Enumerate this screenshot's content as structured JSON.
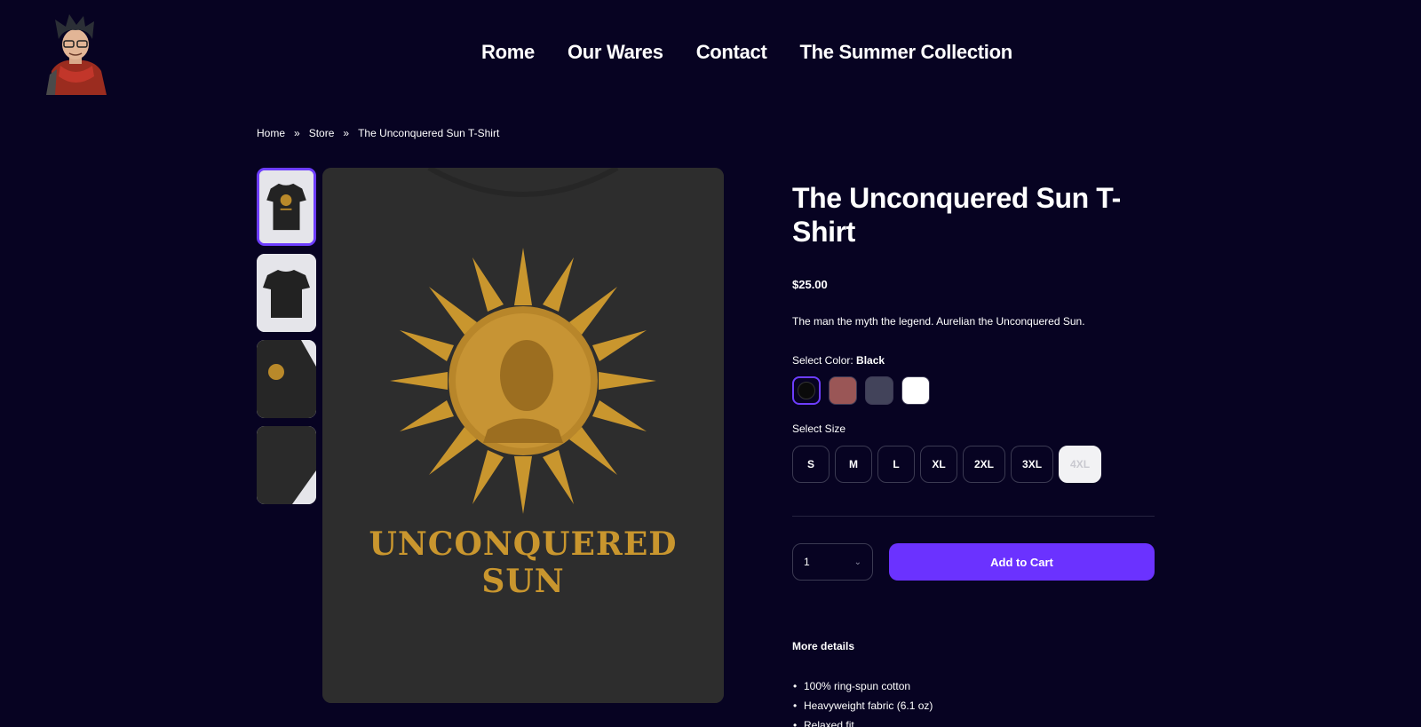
{
  "nav": {
    "items": [
      "Rome",
      "Our Wares",
      "Contact",
      "The Summer Collection"
    ]
  },
  "breadcrumb": {
    "home": "Home",
    "sep1": "»",
    "store": "Store",
    "sep2": "»",
    "current": "The Unconquered Sun T-Shirt"
  },
  "product": {
    "title": "The Unconquered Sun T-Shirt",
    "price": "$25.00",
    "description": "The man the myth the legend. Aurelian the Unconquered Sun.",
    "color_label": "Select Color:",
    "color_selected": "Black",
    "colors": [
      "#0a0a0a",
      "#9a5656",
      "#42435a",
      "#ffffff"
    ],
    "size_label": "Select Size",
    "sizes": [
      "S",
      "M",
      "L",
      "XL",
      "2XL",
      "3XL",
      "4XL"
    ],
    "quantity": "1",
    "add_to_cart": "Add to Cart",
    "more_details": "More details",
    "details": [
      "100% ring-spun cotton",
      "Heavyweight fabric (6.1 oz)",
      "Relaxed fit"
    ],
    "print_text": "UNCONQUERED SUN"
  },
  "colors": {
    "background": "#070322",
    "accent": "#6b32ff",
    "shirt": "#2d2d2d",
    "gold": "#c9962e"
  }
}
